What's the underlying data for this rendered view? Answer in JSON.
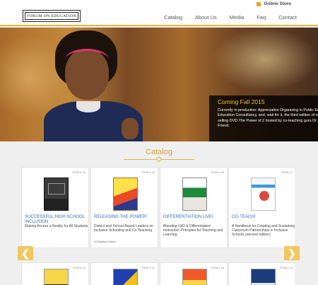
{
  "topbar": {
    "store_label": "Online Store"
  },
  "header": {
    "logo_text": "FORUM ON EDUCATION",
    "nav": [
      "Catalog",
      "About Us",
      "Media",
      "Faq",
      "Contact"
    ]
  },
  "hero": {
    "title": "Coming Fall 2015",
    "lines": [
      "Currently in production: Appreciative Organizing in Public Educa",
      "Education Consultancy, and, wait for it, the third edition of our",
      "selling DVD The Power of 2 hosted by co-teaching guru Dr. M",
      "Friend."
    ],
    "slides": 4
  },
  "catalog": {
    "title": "Catalog",
    "items": [
      {
        "item": "ITEM # 16",
        "title": "SUCCESSFUL HIGH SCHOOL INCLUSION",
        "desc": "Making Access a Reality for All Students",
        "author": ""
      },
      {
        "item": "ITEM # 15",
        "title": "RELEASING THE POWER!",
        "desc": "District and School-Based Leaders on Inclusive Schooling and Co-Teaching",
        "author": "Dr. Marilyn Friend"
      },
      {
        "item": "ITEM # 25",
        "title": "DIFFERENTIATION LIVE!",
        "desc": "Blending UbD & Differentiated Instruction Principles for Teaching and Learning",
        "author": ""
      },
      {
        "item": "ITEM # 7",
        "title": "CO-TEACH!",
        "desc": "A Handbook for Creating and Sustaining Classroom Partnerships in Inclusive Schools (second edition)",
        "author": ""
      }
    ],
    "row2_items": [
      "ITEM # 10",
      "ITEM # 12",
      "ITEM # 18",
      "ITEM # 24"
    ],
    "prev": "❮",
    "next": "❯"
  },
  "colors": {
    "accent": "#e6b840",
    "link": "#2e6fb0",
    "arrow": "#f0c860"
  }
}
